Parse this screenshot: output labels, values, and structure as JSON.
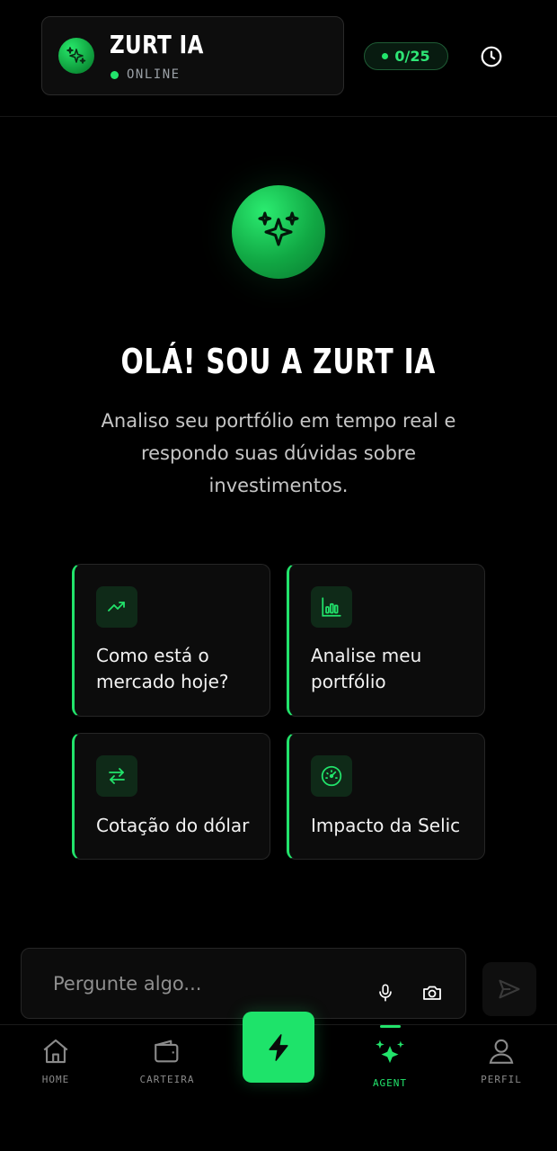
{
  "header": {
    "title": "ZURT IA",
    "status": "ONLINE",
    "counter": "0/25",
    "accent_color": "#22e36b"
  },
  "hero": {
    "title": "OLÁ! SOU A ZURT IA",
    "subtitle_lines": [
      "Analiso seu portfólio em tempo real e",
      "respondo suas dúvidas sobre",
      "investimentos."
    ]
  },
  "suggestions": [
    {
      "icon": "trending-up-icon",
      "lines": [
        "Como está o",
        "mercado hoje?"
      ]
    },
    {
      "icon": "bar-chart-icon",
      "lines": [
        "Analise meu",
        "portfólio"
      ]
    },
    {
      "icon": "exchange-arrows-icon",
      "lines": [
        "Cotação do dólar"
      ]
    },
    {
      "icon": "speedometer-icon",
      "lines": [
        "Impacto da Selic"
      ]
    }
  ],
  "input": {
    "placeholder": "Pergunte algo..."
  },
  "nav": {
    "home": "HOME",
    "wallet": "CARTEIRA",
    "agent": "AGENT",
    "profile": "PERFIL",
    "active": "agent"
  }
}
